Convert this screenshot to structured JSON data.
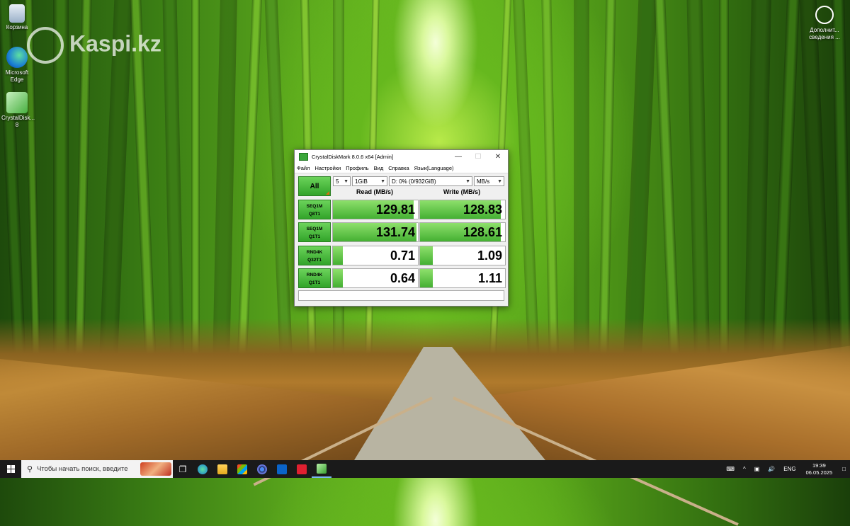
{
  "desktop": {
    "icons": [
      {
        "label": "Корзина",
        "icon": "recycle-bin-icon"
      },
      {
        "label": "Microsoft Edge",
        "icon": "edge-icon"
      },
      {
        "label": "CrystalDisk... 8",
        "icon": "crystaldiskmark-icon"
      }
    ],
    "watermark": "Kaspi.kz",
    "corner_info": "Дополнит... сведения ..."
  },
  "window": {
    "title": "CrystalDiskMark 8.0.6 x64 [Admin]",
    "menu": [
      "Файл",
      "Настройки",
      "Профиль",
      "Вид",
      "Справка",
      "Язык(Language)"
    ],
    "all_button": "All",
    "count": "5",
    "size": "1GiB",
    "drive": "D: 0% (0/932GiB)",
    "unit": "MB/s",
    "read_header": "Read (MB/s)",
    "write_header": "Write (MB/s)",
    "rows": [
      {
        "line1": "SEQ1M",
        "line2": "Q8T1",
        "read": "129.81",
        "write": "128.83",
        "read_level": 0.95,
        "write_level": 0.95
      },
      {
        "line1": "SEQ1M",
        "line2": "Q1T1",
        "read": "131.74",
        "write": "128.61",
        "read_level": 0.98,
        "write_level": 0.95
      },
      {
        "line1": "RND4K",
        "line2": "Q32T1",
        "read": "0.71",
        "write": "1.09",
        "read_level": 0.12,
        "write_level": 0.15
      },
      {
        "line1": "RND4K",
        "line2": "Q1T1",
        "read": "0.64",
        "write": "1.11",
        "read_level": 0.12,
        "write_level": 0.15
      }
    ]
  },
  "taskbar": {
    "search_placeholder": "Чтобы начать поиск, введите",
    "lang": "ENG",
    "time": "19:39",
    "date": "06.05.2025"
  }
}
